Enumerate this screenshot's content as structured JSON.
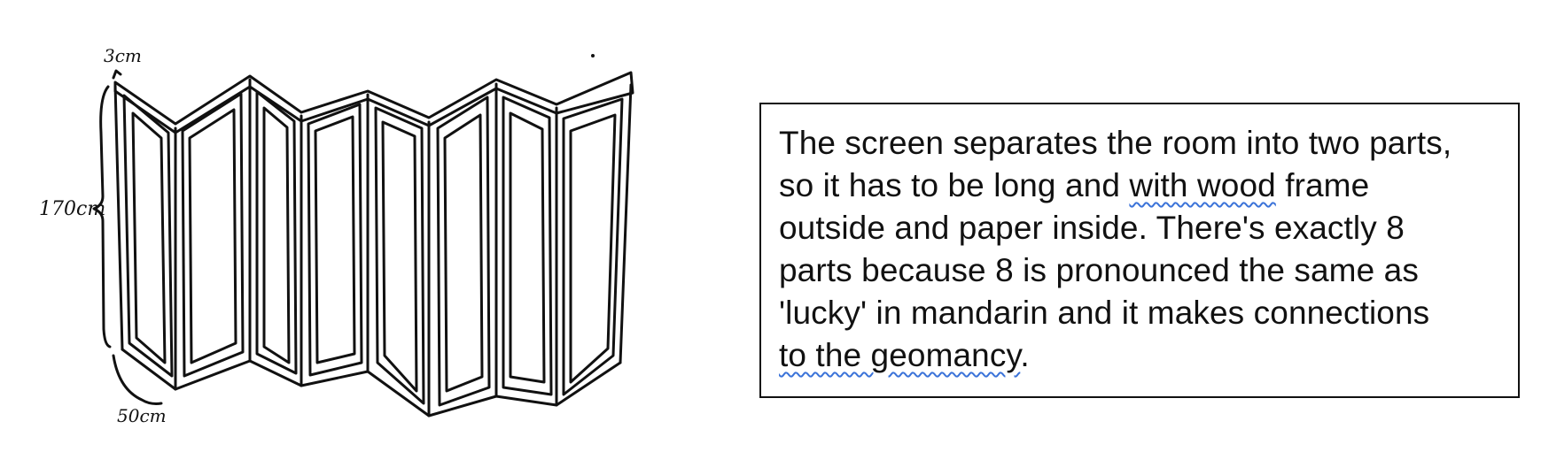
{
  "sketch": {
    "dimensions": {
      "width_label": "3cm",
      "height_label": "170cm",
      "depth_label": "50cm"
    }
  },
  "note": {
    "lines": [
      "The screen separates the room into two parts,",
      "so it has to be long and ",
      "with wood",
      " frame",
      "outside and paper inside. There's exactly 8",
      "parts because 8 is pronounced the same as",
      "'lucky' in mandarin and it makes connections",
      "to the geomancy",
      "."
    ]
  },
  "colors": {
    "ink": "#111111",
    "spellcheck_underline": "#3b73d9"
  }
}
